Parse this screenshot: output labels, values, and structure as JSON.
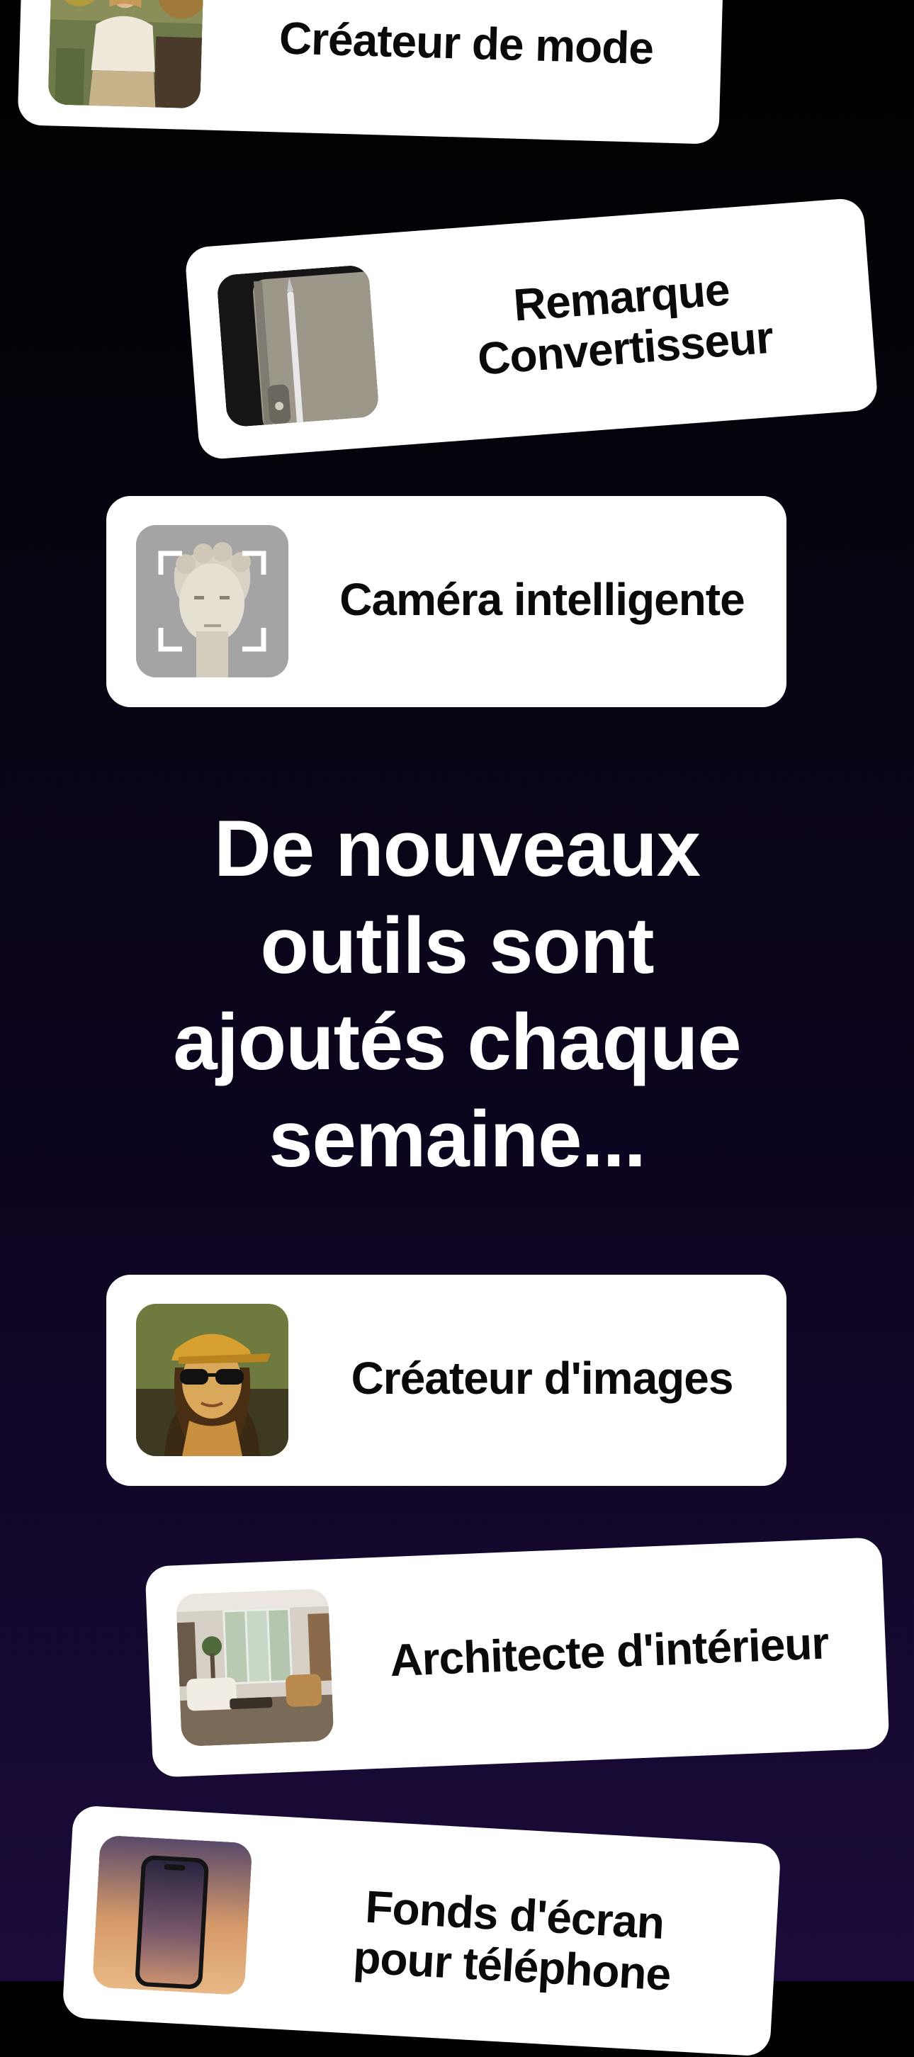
{
  "headline": {
    "lines": [
      "De nouveaux",
      "outils sont",
      "ajoutés chaque",
      "semaine..."
    ]
  },
  "tools": [
    {
      "id": "fashion",
      "label_lines": [
        "Créateur de mode"
      ],
      "icon": "fashion-photo-icon"
    },
    {
      "id": "note",
      "label_lines": [
        "Remarque",
        "Convertisseur"
      ],
      "icon": "notebook-pen-icon"
    },
    {
      "id": "camera",
      "label_lines": [
        "Caméra intelligente"
      ],
      "icon": "statue-scan-icon"
    },
    {
      "id": "images",
      "label_lines": [
        "Créateur d'images"
      ],
      "icon": "portrait-art-icon"
    },
    {
      "id": "interior",
      "label_lines": [
        "Architecte d'intérieur"
      ],
      "icon": "living-room-icon"
    },
    {
      "id": "wallpaper",
      "label_lines": [
        "Fonds d'écran",
        "pour téléphone"
      ],
      "icon": "phone-wallpaper-icon"
    }
  ],
  "colors": {
    "background_top": "#000000",
    "background_bottom": "#1b0b3a",
    "card": "#ffffff",
    "label_text": "#0a0a0a",
    "headline_text": "#ffffff"
  }
}
